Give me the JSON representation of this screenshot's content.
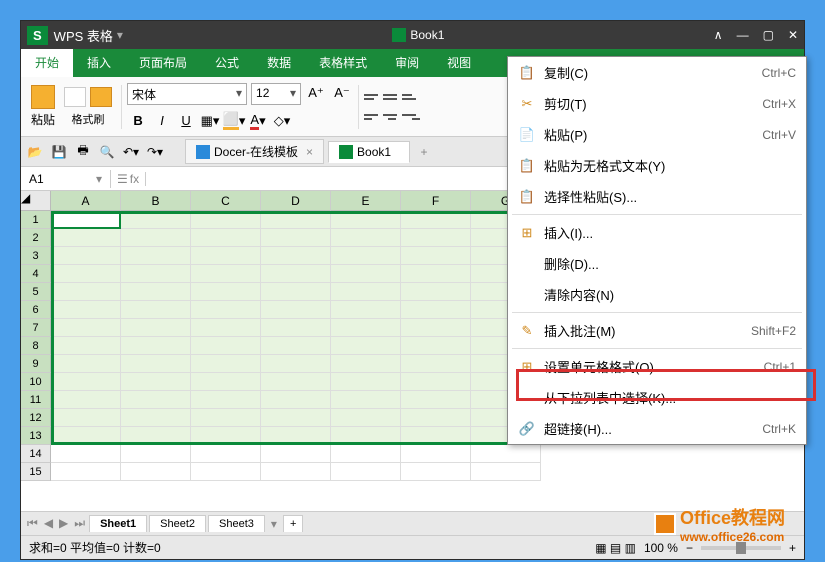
{
  "titlebar": {
    "logo": "S",
    "app_name": "WPS 表格",
    "doc_title": "Book1"
  },
  "menus": [
    "开始",
    "插入",
    "页面布局",
    "公式",
    "数据",
    "表格样式",
    "审阅",
    "视图"
  ],
  "ribbon": {
    "paste": "粘贴",
    "brush": "格式刷",
    "font_name": "宋体",
    "font_size": "12",
    "bold": "B",
    "italic": "I",
    "underline": "U",
    "font_inc": "A⁺",
    "font_dec": "A⁻"
  },
  "doctabs": [
    {
      "label": "Docer-在线模板",
      "active": false
    },
    {
      "label": "Book1",
      "active": true
    }
  ],
  "formulabar": {
    "cell_ref": "A1",
    "fx": "fx"
  },
  "columns": [
    "A",
    "B",
    "C",
    "D",
    "E",
    "F",
    "G"
  ],
  "rows": [
    "1",
    "2",
    "3",
    "4",
    "5",
    "6",
    "7",
    "8",
    "9",
    "10",
    "11",
    "12",
    "13",
    "14",
    "15"
  ],
  "sel_rows": 13,
  "sel_cols": 7,
  "sheets": [
    "Sheet1",
    "Sheet2",
    "Sheet3"
  ],
  "add_sheet": "+",
  "statusbar": {
    "stats": "求和=0  平均值=0  计数=0",
    "zoom": "100 %"
  },
  "context_menu": [
    {
      "icon": "📋",
      "label": "复制(C)",
      "shortcut": "Ctrl+C"
    },
    {
      "icon": "✂",
      "label": "剪切(T)",
      "shortcut": "Ctrl+X"
    },
    {
      "icon": "📄",
      "label": "粘贴(P)",
      "shortcut": "Ctrl+V"
    },
    {
      "icon": "📋",
      "label": "粘贴为无格式文本(Y)",
      "shortcut": ""
    },
    {
      "icon": "📋",
      "label": "选择性粘贴(S)...",
      "shortcut": ""
    },
    {
      "sep": true
    },
    {
      "icon": "⊞",
      "label": "插入(I)...",
      "shortcut": ""
    },
    {
      "icon": "",
      "label": "删除(D)...",
      "shortcut": ""
    },
    {
      "icon": "",
      "label": "清除内容(N)",
      "shortcut": ""
    },
    {
      "sep": true
    },
    {
      "icon": "✎",
      "label": "插入批注(M)",
      "shortcut": "Shift+F2"
    },
    {
      "sep": true
    },
    {
      "icon": "⊞",
      "label": "设置单元格格式(O)...",
      "shortcut": "Ctrl+1",
      "highlight": true
    },
    {
      "icon": "",
      "label": "从下拉列表中选择(K)...",
      "shortcut": ""
    },
    {
      "icon": "🔗",
      "label": "超链接(H)...",
      "shortcut": "Ctrl+K"
    }
  ],
  "watermark": {
    "brand": "Office教程网",
    "url": "www.office26.com"
  }
}
